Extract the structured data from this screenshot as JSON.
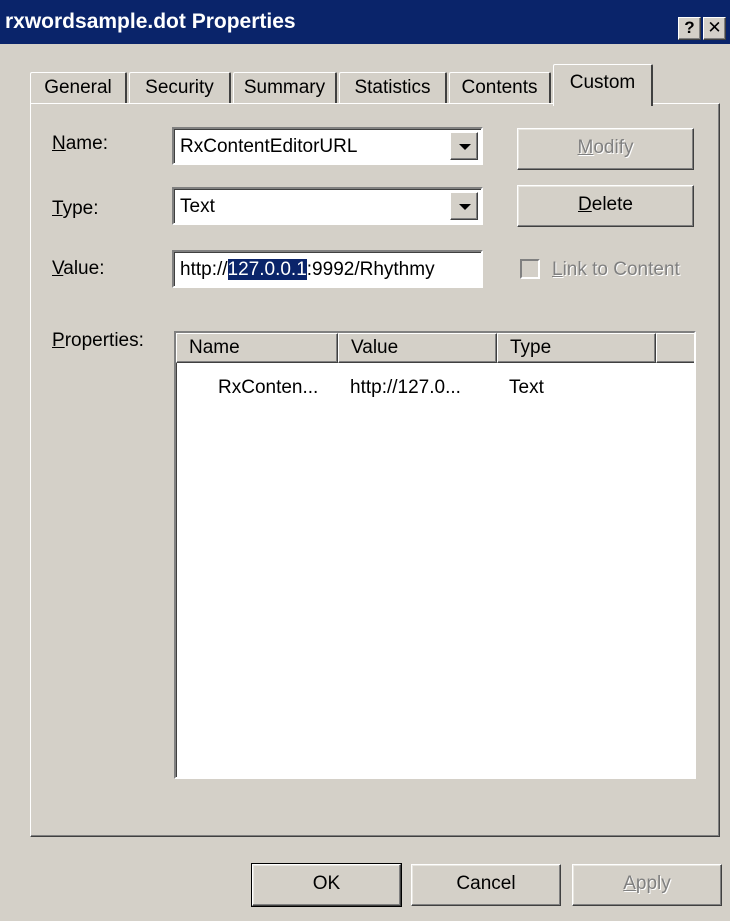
{
  "window": {
    "title": "rxwordsample.dot Properties",
    "help_label": "?",
    "close_label": "✕"
  },
  "tabs": [
    {
      "label": "General"
    },
    {
      "label": "Security"
    },
    {
      "label": "Summary"
    },
    {
      "label": "Statistics"
    },
    {
      "label": "Contents"
    },
    {
      "label": "Custom",
      "active": true
    }
  ],
  "form": {
    "name_label_key": "N",
    "name_label_rest": "ame:",
    "name_value": "RxContentEditorURL",
    "type_label_key": "T",
    "type_label_rest": "ype:",
    "type_value": "Text",
    "value_label_key": "V",
    "value_label_rest": "alue:",
    "value_before": "http://",
    "value_selected": "127.0.0.1",
    "value_after": ":9992/Rhythmy",
    "properties_label_key": "P",
    "properties_label_rest": "roperties:"
  },
  "buttons": {
    "modify_key": "M",
    "modify_rest": "odify",
    "delete_key": "D",
    "delete_rest": "elete",
    "link_key": "L",
    "link_rest": "ink to Content",
    "ok": "OK",
    "cancel": "Cancel",
    "apply_key": "A",
    "apply_rest": "pply"
  },
  "properties_list": {
    "columns": [
      "Name",
      "Value",
      "Type"
    ],
    "rows": [
      {
        "name": "RxConten...",
        "value": "http://127.0...",
        "type": "Text"
      }
    ]
  },
  "colors": {
    "titlebar": "#0a246a",
    "face": "#d4d0c8",
    "selection": "#0a246a"
  }
}
